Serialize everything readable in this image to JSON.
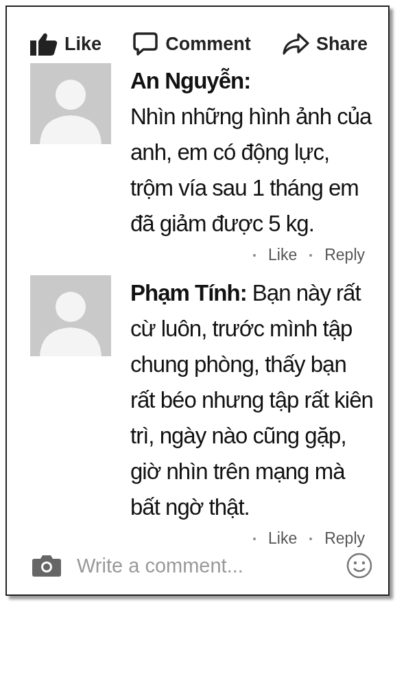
{
  "actions": [
    {
      "kind": "like",
      "label": "Like"
    },
    {
      "kind": "comment",
      "label": "Comment"
    },
    {
      "kind": "share",
      "label": "Share"
    }
  ],
  "comments": [
    {
      "kind": "block",
      "name": "An Nguyễn:",
      "text": "Nhìn những hình ảnh của anh, em có động lực, trộm vía sau 1 tháng em đã giảm được 5 kg.",
      "like": "Like",
      "reply": "Reply"
    },
    {
      "kind": "inline",
      "name": "Phạm Tính:",
      "text": "Bạn này rất cừ luôn, trước mình tập chung phòng, thấy bạn rất béo nhưng tập rất kiên trì, ngày nào cũng gặp, giờ nhìn trên mạng mà bất ngờ thật.",
      "like": "Like",
      "reply": "Reply"
    }
  ],
  "composer": {
    "placeholder": "Write a comment..."
  }
}
